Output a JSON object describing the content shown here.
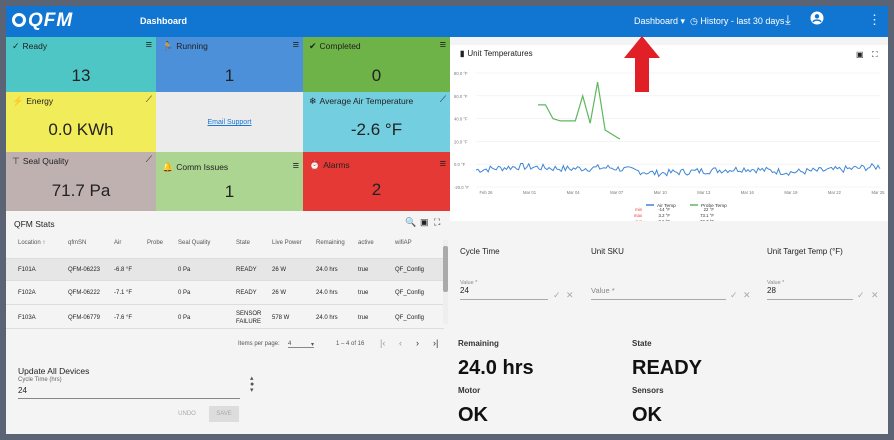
{
  "app": {
    "logo": "QFM",
    "title": "Dashboard"
  },
  "topbar": {
    "menu_label": "Dashboard",
    "history_label": "History - last 30 days",
    "download_icon": "download-icon",
    "account_icon": "account-icon",
    "more_icon": "more-vert-icon"
  },
  "tiles": [
    {
      "label": "Ready",
      "value": "13",
      "color": "#4fc6c6",
      "icon": "check-icon"
    },
    {
      "label": "Running",
      "value": "1",
      "color": "#4b90d9",
      "icon": "run-icon"
    },
    {
      "label": "Completed",
      "value": "0",
      "color": "#6db347",
      "icon": "done-all-icon"
    },
    {
      "label": "Energy",
      "value": "0.0 KWh",
      "color": "#f1ec59",
      "icon": "bolt-icon"
    },
    {
      "label": "",
      "value": "Email Support",
      "color": "#ececec",
      "icon": ""
    },
    {
      "label": "Average Air Temperature",
      "value": "-2.6 °F",
      "color": "#73cfe0",
      "icon": "snowflake-icon"
    },
    {
      "label": "Seal Quality",
      "value": "71.7 Pa",
      "color": "#c0b1b1",
      "icon": "seal-icon"
    },
    {
      "label": "Comm Issues",
      "value": "1",
      "color": "#abd590",
      "icon": "bell-icon"
    },
    {
      "label": "Alarms",
      "value": "2",
      "color": "#e53935",
      "icon": "alarm-icon"
    }
  ],
  "stats": {
    "title": "QFM Stats",
    "columns": [
      "Location ↑",
      "qfmSN",
      "Air",
      "Probe",
      "Seal Quality",
      "State",
      "Live Power",
      "Remaining",
      "active",
      "wifiAP"
    ],
    "rows": [
      [
        "F101A",
        "QFM-06223",
        "-6.8 °F",
        "",
        "0 Pa",
        "READY",
        "26 W",
        "24.0 hrs",
        "true",
        "QF_Config"
      ],
      [
        "F102A",
        "QFM-06222",
        "-7.1 °F",
        "",
        "0 Pa",
        "READY",
        "26 W",
        "24.0 hrs",
        "true",
        "QF_Config"
      ],
      [
        "F103A",
        "QFM-06779",
        "-7.6 °F",
        "",
        "0 Pa",
        "SENSOR FAILURE",
        "578 W",
        "24.0 hrs",
        "true",
        "QF_Config"
      ]
    ],
    "items_per_page_label": "Items per page:",
    "items_per_page": "4",
    "range": "1 – 4 of 16"
  },
  "update": {
    "title": "Update All Devices",
    "field_label": "Cycle Time (hrs)",
    "field_value": "24",
    "undo": "UNDO",
    "save": "SAVE"
  },
  "chart_data": {
    "type": "line",
    "title": "Unit Temperatures",
    "x": [
      "Feb 26",
      "Mar 01",
      "Mar 04",
      "Mar 07",
      "Mar 10",
      "Mar 13",
      "Mar 16",
      "Mar 19",
      "Mar 22",
      "Mar 25"
    ],
    "y_ticks": [
      "80.0 °F",
      "60.0 °F",
      "40.0 °F",
      "20.0 °F",
      "0.0 °F",
      "-20.0 °F"
    ],
    "ylim": [
      -20,
      80
    ],
    "series": [
      {
        "name": "Air Temp",
        "color": "#3f86d4",
        "values": [
          -5,
          -2,
          -4,
          -3,
          -8,
          -6,
          -4,
          -7,
          -5,
          -2
        ],
        "stats": {
          "min": "-14 °F",
          "max": "3.2 °F",
          "avg": "-8.6 °F"
        }
      },
      {
        "name": "Probe Temp",
        "color": "#5cb85c",
        "values": [
          52,
          38,
          44,
          72,
          25,
          22
        ],
        "stats": {
          "min": "22 °F",
          "max": "73.1 °F",
          "avg": "32.7 °F"
        }
      }
    ],
    "stat_labels": [
      "min",
      "max",
      "avg"
    ]
  },
  "settings": {
    "cycle_time_label": "Cycle Time",
    "cycle_value_label": "Value *",
    "cycle_value": "24",
    "sku_label": "Unit SKU",
    "sku_placeholder": "Value *",
    "target_label": "Unit Target Temp (°F)",
    "target_value_label": "Value *",
    "target_value": "28"
  },
  "status": {
    "remaining_label": "Remaining",
    "remaining_value": "24.0 hrs",
    "state_label": "State",
    "state_value": "READY",
    "motor_label": "Motor",
    "motor_value": "OK",
    "sensors_label": "Sensors",
    "sensors_value": "OK"
  }
}
